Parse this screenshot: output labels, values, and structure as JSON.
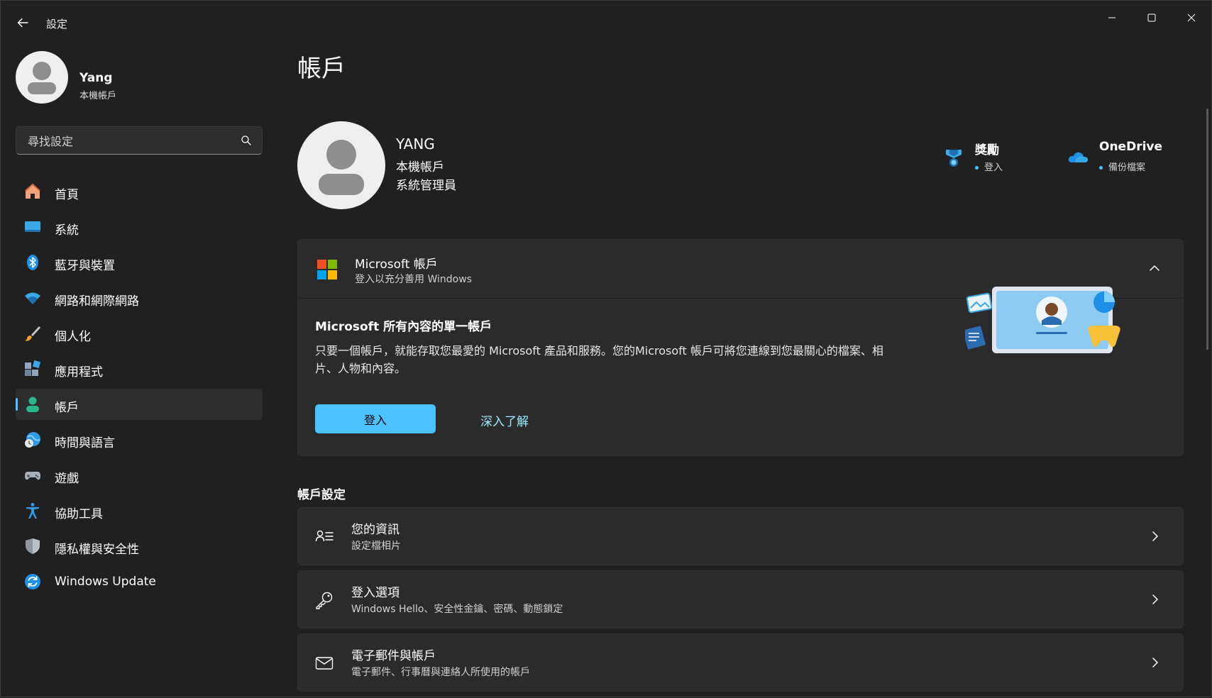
{
  "window": {
    "title": "設定"
  },
  "profile": {
    "name": "Yang",
    "account_type": "本機帳戶"
  },
  "search": {
    "placeholder": "尋找設定"
  },
  "nav": [
    {
      "label": "首頁",
      "icon": "home-icon"
    },
    {
      "label": "系統",
      "icon": "system-icon"
    },
    {
      "label": "藍牙與裝置",
      "icon": "bluetooth-icon"
    },
    {
      "label": "網路和網際網路",
      "icon": "wifi-icon"
    },
    {
      "label": "個人化",
      "icon": "brush-icon"
    },
    {
      "label": "應用程式",
      "icon": "apps-icon"
    },
    {
      "label": "帳戶",
      "icon": "account-icon",
      "active": true
    },
    {
      "label": "時間與語言",
      "icon": "globe-clock-icon"
    },
    {
      "label": "遊戲",
      "icon": "gamepad-icon"
    },
    {
      "label": "協助工具",
      "icon": "accessibility-icon"
    },
    {
      "label": "隱私權與安全性",
      "icon": "shield-icon"
    },
    {
      "label": "Windows Update",
      "icon": "update-icon"
    }
  ],
  "page": {
    "title": "帳戶"
  },
  "user": {
    "name": "YANG",
    "account_type": "本機帳戶",
    "role": "系統管理員"
  },
  "quick_links": {
    "rewards": {
      "title": "獎勵",
      "sub": "登入"
    },
    "onedrive": {
      "title": "OneDrive",
      "sub": "備份檔案"
    }
  },
  "microsoft_card": {
    "title": "Microsoft 帳戶",
    "subtitle": "登入以充分善用 Windows",
    "body_title": "Microsoft 所有內容的單一帳戶",
    "body_desc": "只要一個帳戶，就能存取您最愛的 Microsoft 產品和服務。您的Microsoft 帳戶可將您連線到您最關心的檔案、相片、人物和內容。",
    "signin_label": "登入",
    "learn_more_label": "深入了解"
  },
  "account_settings": {
    "section_title": "帳戶設定",
    "rows": [
      {
        "title": "您的資訊",
        "sub": "設定檔相片",
        "icon": "person-list-icon"
      },
      {
        "title": "登入選項",
        "sub": "Windows Hello、安全性金鑰、密碼、動態鎖定",
        "icon": "key-icon"
      },
      {
        "title": "電子郵件與帳戶",
        "sub": "電子郵件、行事曆與連絡人所使用的帳戶",
        "icon": "mail-icon"
      }
    ]
  },
  "colors": {
    "background": "#202020",
    "card": "#2b2b2b",
    "accent": "#4cc2ff",
    "link": "#99ebff"
  }
}
